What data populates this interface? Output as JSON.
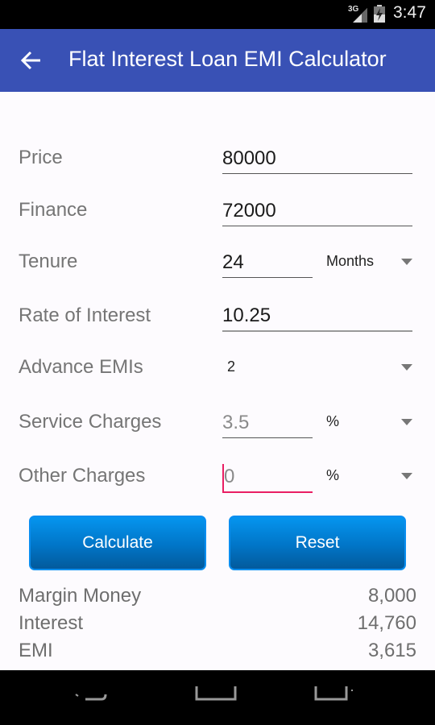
{
  "status_bar": {
    "network": "3G",
    "time": "3:47"
  },
  "app_bar": {
    "title": "Flat Interest Loan EMI Calculator",
    "back_icon": "arrow-left-icon"
  },
  "form": {
    "price": {
      "label": "Price",
      "value": "80000"
    },
    "finance": {
      "label": "Finance",
      "value": "72000"
    },
    "tenure": {
      "label": "Tenure",
      "value": "24",
      "unit": "Months"
    },
    "rate": {
      "label": "Rate of Interest",
      "value": "10.25"
    },
    "advance_emis": {
      "label": "Advance EMIs",
      "value": "2"
    },
    "service_charges": {
      "label": "Service Charges",
      "value": "3.5",
      "unit": "%"
    },
    "other_charges": {
      "label": "Other Charges",
      "value": "0",
      "unit": "%"
    }
  },
  "buttons": {
    "calculate": "Calculate",
    "reset": "Reset"
  },
  "results": [
    {
      "label": "Margin Money",
      "value": "8,000"
    },
    {
      "label": "Interest",
      "value": "14,760"
    },
    {
      "label": "EMI",
      "value": "3,615"
    }
  ],
  "colors": {
    "app_bar": "#3951b5",
    "accent": "#e91e63",
    "button": "#0175c7"
  }
}
